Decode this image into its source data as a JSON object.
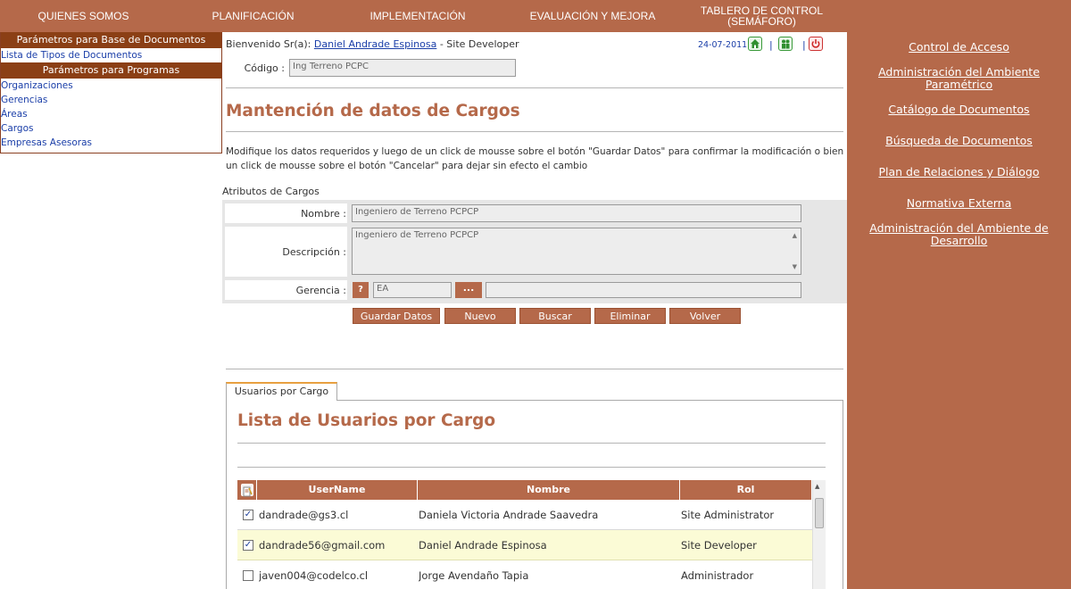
{
  "nav": {
    "items": [
      {
        "label": "QUIENES SOMOS"
      },
      {
        "label": "PLANIFICACIÓN"
      },
      {
        "label": "IMPLEMENTACIÓN"
      },
      {
        "label": "EVALUACIÓN Y MEJORA"
      },
      {
        "label_line1": "TABLERO DE CONTROL",
        "label_line2": "(SEMÁFORO)"
      }
    ]
  },
  "sidebar": {
    "header1": "Parámetros para Base de Documentos",
    "group1": [
      "Lista de Tipos de Documentos"
    ],
    "header2": "Parámetros para Programas",
    "group2": [
      "Organizaciones",
      "Gerencias",
      "Áreas",
      "Cargos",
      "Empresas Asesoras"
    ]
  },
  "welcome": {
    "prefix": "Bienvenido Sr(a):",
    "user": "Daniel Andrade Espinosa",
    "role": "- Site Developer",
    "date": "24-07-2011",
    "separator": "|"
  },
  "codigo": {
    "label": "Código :",
    "value": "Ing Terreno PCPC"
  },
  "page_title": "Mantención de datos de Cargos",
  "instructions": "Modifique los datos requeridos y luego de un click de mousse sobre el botón \"Guardar Datos\" para confirmar la modificación o bien un click de mousse sobre el botón \"Cancelar\" para dejar sin efecto el cambio",
  "attributes": {
    "title": "Atributos de Cargos",
    "nombre_label": "Nombre :",
    "nombre_value": "Ingeniero de Terreno PCPCP",
    "descripcion_label": "Descripción :",
    "descripcion_value": "Ingeniero de Terreno PCPCP",
    "gerencia_label": "Gerencia :",
    "gerencia_help": "?",
    "gerencia_code": "EA",
    "gerencia_browse": "...",
    "gerencia_name": ""
  },
  "buttons": {
    "save": "Guardar Datos",
    "new": "Nuevo",
    "search": "Buscar",
    "delete": "Eliminar",
    "back": "Volver"
  },
  "tab": {
    "label": "Usuarios por Cargo"
  },
  "users_list": {
    "title": "Lista de Usuarios por Cargo",
    "columns": [
      "UserName",
      "Nombre",
      "Rol"
    ],
    "rows": [
      {
        "username": "dandrade@gs3.cl",
        "nombre": "Daniela Victoria Andrade Saavedra",
        "rol": "Site Administrator",
        "checked": true
      },
      {
        "username": "dandrade56@gmail.com",
        "nombre": "Daniel Andrade Espinosa",
        "rol": "Site Developer",
        "checked": true
      },
      {
        "username": "javen004@codelco.cl",
        "nombre": "Jorge Avendaño Tapia",
        "rol": "Administrador",
        "checked": false
      }
    ]
  },
  "right_menu": [
    {
      "line1": "Control de Acceso"
    },
    {
      "line1": "Administración del Ambiente",
      "line2": "Paramétrico"
    },
    {
      "line1": "Catálogo de Documentos"
    },
    {
      "line1": "Búsqueda de Documentos"
    },
    {
      "line1": "Plan de Relaciones y Diálogo"
    },
    {
      "line1": "Normativa Externa"
    },
    {
      "line1": "Administración del Ambiente de",
      "line2": "Desarrollo"
    }
  ],
  "colors": {
    "accent": "#b5694a",
    "dark_header": "#8b3f15",
    "link": "#1a3ea8",
    "selected_row": "#fbfbd6"
  }
}
